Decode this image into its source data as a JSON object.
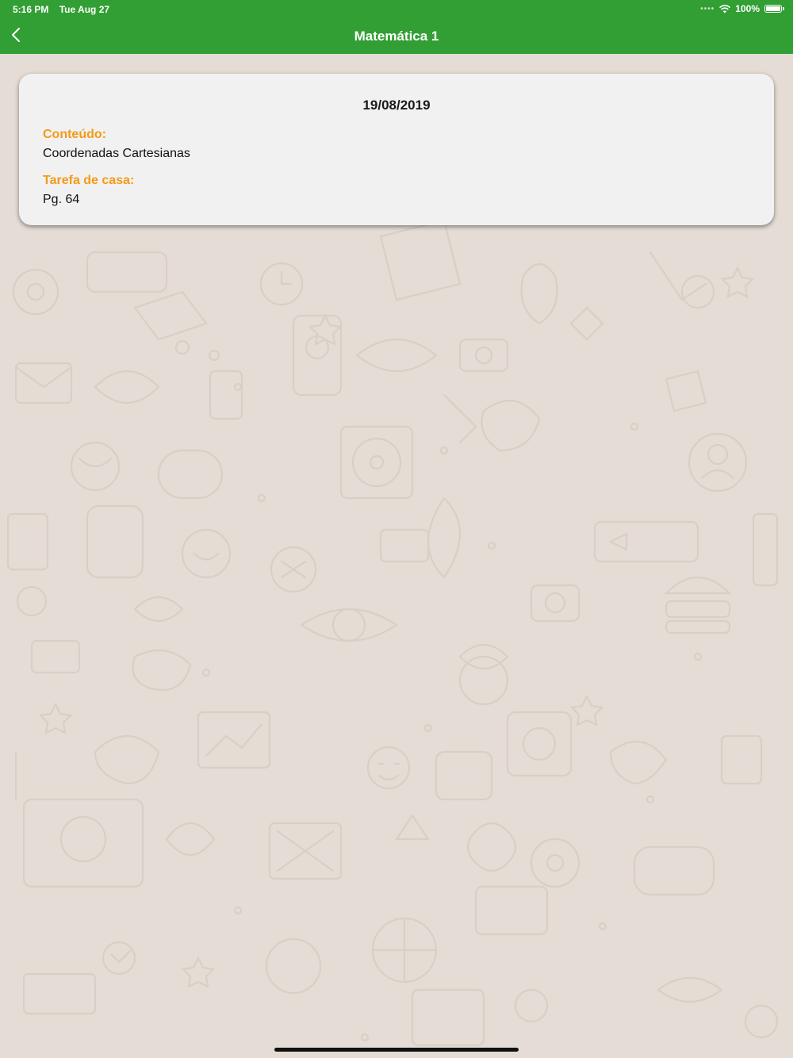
{
  "status_bar": {
    "time": "5:16 PM",
    "date": "Tue Aug 27",
    "battery_text": "100%",
    "icons": [
      "signal-dots-icon",
      "wifi-icon",
      "battery-icon"
    ]
  },
  "nav": {
    "title": "Matemática 1",
    "back_icon": "chevron-left-icon",
    "color": "#319f34"
  },
  "entry": {
    "date": "19/08/2019",
    "content_label": "Conteúdo:",
    "content_value": "Coordenadas Cartesianas",
    "homework_label": "Tarefa de casa:",
    "homework_value": "Pg. 64",
    "label_color": "#f39a16"
  },
  "background": {
    "pattern": "doodle-wallpaper",
    "color": "#e5ddd5"
  }
}
